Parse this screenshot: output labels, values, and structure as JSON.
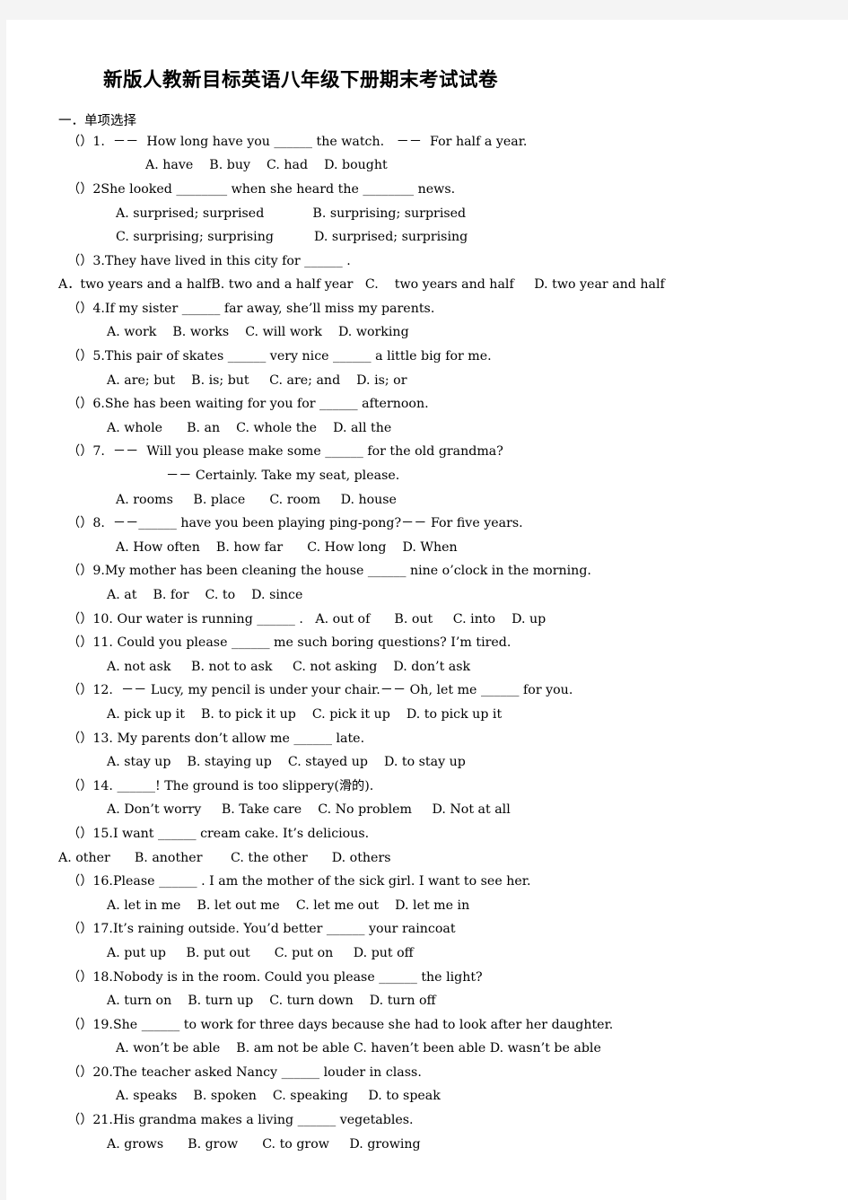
{
  "document": {
    "title": "新版人教新目标英语八年级下册期末考试试卷",
    "section_heading": "一．单项选择"
  },
  "lines": [
    {
      "id": "q1-stem",
      "indent": "ind-q",
      "text": "（）1.  －－  How long have you ______ the watch.   －－  For half a year."
    },
    {
      "id": "q1-opts",
      "indent": "ind-opt3",
      "text": "A. have    B. buy    C. had    D. bought"
    },
    {
      "id": "q2-stem",
      "indent": "ind-q",
      "text": "（）2She looked ________ when she heard the ________ news."
    },
    {
      "id": "q2-optsAB",
      "indent": "ind-opt",
      "text": "A. surprised; surprised            B. surprising; surprised"
    },
    {
      "id": "q2-optsCD",
      "indent": "ind-opt",
      "text": "C. surprising; surprising          D. surprised; surprising"
    },
    {
      "id": "q3-stem",
      "indent": "ind-q",
      "text": "（）3.They have lived in this city for ______ ."
    },
    {
      "id": "q3-opts",
      "indent": "ind-flush",
      "text": "A．two years and a halfB. two and a half year   C.    two years and half     D. two year and half"
    },
    {
      "id": "q4-stem",
      "indent": "ind-q",
      "text": "（）4.If my sister ______ far away, she’ll miss my parents."
    },
    {
      "id": "q4-opts",
      "indent": "ind-opt2",
      "text": "A. work    B. works    C. will work    D. working"
    },
    {
      "id": "q5-stem",
      "indent": "ind-q",
      "text": "（）5.This pair of skates ______ very nice ______ a little big for me."
    },
    {
      "id": "q5-opts",
      "indent": "ind-opt2",
      "text": "A. are; but    B. is; but     C. are; and    D. is; or"
    },
    {
      "id": "q6-stem",
      "indent": "ind-q",
      "text": "（）6.She has been waiting for you for ______ afternoon."
    },
    {
      "id": "q6-opts",
      "indent": "ind-opt2",
      "text": "A. whole      B. an    C. whole the    D. all the"
    },
    {
      "id": "q7-stem",
      "indent": "ind-q",
      "text": "（）7.  －－  Will you please make some ______ for the old grandma?"
    },
    {
      "id": "q7-reply",
      "indent": "ind-dash",
      "text": "－－ Certainly. Take my seat, please."
    },
    {
      "id": "q7-opts",
      "indent": "ind-opt",
      "text": "A. rooms     B. place      C. room     D. house"
    },
    {
      "id": "q8-stem",
      "indent": "ind-q",
      "text": "（）8.  －－______ have you been playing ping-pong?－－ For five years."
    },
    {
      "id": "q8-opts",
      "indent": "ind-opt",
      "text": "A. How often    B. how far      C. How long    D. When"
    },
    {
      "id": "q9-stem",
      "indent": "ind-q",
      "text": "（）9.My mother has been cleaning the house ______ nine o’clock in the morning."
    },
    {
      "id": "q9-opts",
      "indent": "ind-opt2",
      "text": "A. at    B. for    C. to    D. since"
    },
    {
      "id": "q10-line",
      "indent": "ind-q",
      "text": "（）10. Our water is running ______ .   A. out of      B. out     C. into    D. up"
    },
    {
      "id": "q11-stem",
      "indent": "ind-q",
      "text": "（）11. Could you please ______ me such boring questions? I’m tired."
    },
    {
      "id": "q11-opts",
      "indent": "ind-opt2",
      "text": "A. not ask     B. not to ask     C. not asking    D. don’t ask"
    },
    {
      "id": "q12-stem",
      "indent": "ind-q",
      "text": "（）12.  －－ Lucy, my pencil is under your chair.－－ Oh, let me ______ for you."
    },
    {
      "id": "q12-opts",
      "indent": "ind-opt2",
      "text": "A. pick up it    B. to pick it up    C. pick it up    D. to pick up it"
    },
    {
      "id": "q13-stem",
      "indent": "ind-q",
      "text": "（）13. My parents don’t allow me ______ late."
    },
    {
      "id": "q13-opts",
      "indent": "ind-opt2",
      "text": "A. stay up    B. staying up    C. stayed up    D. to stay up"
    },
    {
      "id": "q14-stem",
      "indent": "ind-q",
      "text": "（）14. ______! The ground is too slippery(滑的)."
    },
    {
      "id": "q14-opts",
      "indent": "ind-opt2",
      "text": "A. Don’t worry     B. Take care    C. No problem     D. Not at all"
    },
    {
      "id": "q15-stem",
      "indent": "ind-q",
      "text": "（）15.I want ______ cream cake. It’s delicious."
    },
    {
      "id": "q15-opts",
      "indent": "ind-flush",
      "text": "A. other      B. another       C. the other      D. others"
    },
    {
      "id": "q16-stem",
      "indent": "ind-q",
      "text": "（）16.Please ______ . I am the mother of the sick girl. I want to see her."
    },
    {
      "id": "q16-opts",
      "indent": "ind-opt2",
      "text": "A. let in me    B. let out me    C. let me out    D. let me in"
    },
    {
      "id": "q17-stem",
      "indent": "ind-q",
      "text": "（）17.It’s raining outside. You’d better ______ your raincoat"
    },
    {
      "id": "q17-opts",
      "indent": "ind-opt2",
      "text": "A. put up     B. put out      C. put on     D. put off"
    },
    {
      "id": "q18-stem",
      "indent": "ind-q",
      "text": "（）18.Nobody is in the room. Could you please ______ the light?"
    },
    {
      "id": "q18-opts",
      "indent": "ind-opt2",
      "text": "A. turn on    B. turn up    C. turn down    D. turn off"
    },
    {
      "id": "q19-stem",
      "indent": "ind-q",
      "text": "（）19.She ______ to work for three days because she had to look after her daughter."
    },
    {
      "id": "q19-opts",
      "indent": "ind-opt",
      "text": "A. won’t be able    B. am not be able C. haven’t been able D. wasn’t be able"
    },
    {
      "id": "q20-stem",
      "indent": "ind-q",
      "text": "（）20.The teacher asked Nancy ______ louder in class."
    },
    {
      "id": "q20-opts",
      "indent": "ind-opt",
      "text": "A. speaks    B. spoken    C. speaking     D. to speak"
    },
    {
      "id": "q21-stem",
      "indent": "ind-q",
      "text": "（）21.His grandma makes a living ______ vegetables."
    },
    {
      "id": "q21-opts",
      "indent": "ind-opt2",
      "text": "A. grows      B. grow      C. to grow     D. growing"
    }
  ]
}
